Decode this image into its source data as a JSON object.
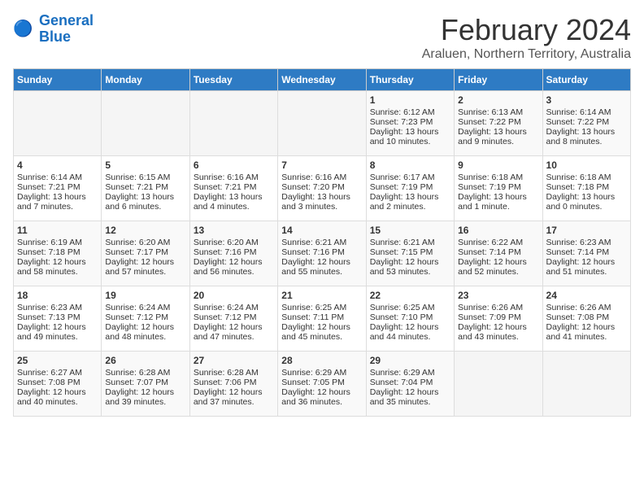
{
  "logo": {
    "text_general": "General",
    "text_blue": "Blue"
  },
  "title": "February 2024",
  "subtitle": "Araluen, Northern Territory, Australia",
  "headers": [
    "Sunday",
    "Monday",
    "Tuesday",
    "Wednesday",
    "Thursday",
    "Friday",
    "Saturday"
  ],
  "weeks": [
    [
      {
        "day": "",
        "lines": []
      },
      {
        "day": "",
        "lines": []
      },
      {
        "day": "",
        "lines": []
      },
      {
        "day": "",
        "lines": []
      },
      {
        "day": "1",
        "lines": [
          "Sunrise: 6:12 AM",
          "Sunset: 7:23 PM",
          "Daylight: 13 hours",
          "and 10 minutes."
        ]
      },
      {
        "day": "2",
        "lines": [
          "Sunrise: 6:13 AM",
          "Sunset: 7:22 PM",
          "Daylight: 13 hours",
          "and 9 minutes."
        ]
      },
      {
        "day": "3",
        "lines": [
          "Sunrise: 6:14 AM",
          "Sunset: 7:22 PM",
          "Daylight: 13 hours",
          "and 8 minutes."
        ]
      }
    ],
    [
      {
        "day": "4",
        "lines": [
          "Sunrise: 6:14 AM",
          "Sunset: 7:21 PM",
          "Daylight: 13 hours",
          "and 7 minutes."
        ]
      },
      {
        "day": "5",
        "lines": [
          "Sunrise: 6:15 AM",
          "Sunset: 7:21 PM",
          "Daylight: 13 hours",
          "and 6 minutes."
        ]
      },
      {
        "day": "6",
        "lines": [
          "Sunrise: 6:16 AM",
          "Sunset: 7:21 PM",
          "Daylight: 13 hours",
          "and 4 minutes."
        ]
      },
      {
        "day": "7",
        "lines": [
          "Sunrise: 6:16 AM",
          "Sunset: 7:20 PM",
          "Daylight: 13 hours",
          "and 3 minutes."
        ]
      },
      {
        "day": "8",
        "lines": [
          "Sunrise: 6:17 AM",
          "Sunset: 7:19 PM",
          "Daylight: 13 hours",
          "and 2 minutes."
        ]
      },
      {
        "day": "9",
        "lines": [
          "Sunrise: 6:18 AM",
          "Sunset: 7:19 PM",
          "Daylight: 13 hours",
          "and 1 minute."
        ]
      },
      {
        "day": "10",
        "lines": [
          "Sunrise: 6:18 AM",
          "Sunset: 7:18 PM",
          "Daylight: 13 hours",
          "and 0 minutes."
        ]
      }
    ],
    [
      {
        "day": "11",
        "lines": [
          "Sunrise: 6:19 AM",
          "Sunset: 7:18 PM",
          "Daylight: 12 hours",
          "and 58 minutes."
        ]
      },
      {
        "day": "12",
        "lines": [
          "Sunrise: 6:20 AM",
          "Sunset: 7:17 PM",
          "Daylight: 12 hours",
          "and 57 minutes."
        ]
      },
      {
        "day": "13",
        "lines": [
          "Sunrise: 6:20 AM",
          "Sunset: 7:16 PM",
          "Daylight: 12 hours",
          "and 56 minutes."
        ]
      },
      {
        "day": "14",
        "lines": [
          "Sunrise: 6:21 AM",
          "Sunset: 7:16 PM",
          "Daylight: 12 hours",
          "and 55 minutes."
        ]
      },
      {
        "day": "15",
        "lines": [
          "Sunrise: 6:21 AM",
          "Sunset: 7:15 PM",
          "Daylight: 12 hours",
          "and 53 minutes."
        ]
      },
      {
        "day": "16",
        "lines": [
          "Sunrise: 6:22 AM",
          "Sunset: 7:14 PM",
          "Daylight: 12 hours",
          "and 52 minutes."
        ]
      },
      {
        "day": "17",
        "lines": [
          "Sunrise: 6:23 AM",
          "Sunset: 7:14 PM",
          "Daylight: 12 hours",
          "and 51 minutes."
        ]
      }
    ],
    [
      {
        "day": "18",
        "lines": [
          "Sunrise: 6:23 AM",
          "Sunset: 7:13 PM",
          "Daylight: 12 hours",
          "and 49 minutes."
        ]
      },
      {
        "day": "19",
        "lines": [
          "Sunrise: 6:24 AM",
          "Sunset: 7:12 PM",
          "Daylight: 12 hours",
          "and 48 minutes."
        ]
      },
      {
        "day": "20",
        "lines": [
          "Sunrise: 6:24 AM",
          "Sunset: 7:12 PM",
          "Daylight: 12 hours",
          "and 47 minutes."
        ]
      },
      {
        "day": "21",
        "lines": [
          "Sunrise: 6:25 AM",
          "Sunset: 7:11 PM",
          "Daylight: 12 hours",
          "and 45 minutes."
        ]
      },
      {
        "day": "22",
        "lines": [
          "Sunrise: 6:25 AM",
          "Sunset: 7:10 PM",
          "Daylight: 12 hours",
          "and 44 minutes."
        ]
      },
      {
        "day": "23",
        "lines": [
          "Sunrise: 6:26 AM",
          "Sunset: 7:09 PM",
          "Daylight: 12 hours",
          "and 43 minutes."
        ]
      },
      {
        "day": "24",
        "lines": [
          "Sunrise: 6:26 AM",
          "Sunset: 7:08 PM",
          "Daylight: 12 hours",
          "and 41 minutes."
        ]
      }
    ],
    [
      {
        "day": "25",
        "lines": [
          "Sunrise: 6:27 AM",
          "Sunset: 7:08 PM",
          "Daylight: 12 hours",
          "and 40 minutes."
        ]
      },
      {
        "day": "26",
        "lines": [
          "Sunrise: 6:28 AM",
          "Sunset: 7:07 PM",
          "Daylight: 12 hours",
          "and 39 minutes."
        ]
      },
      {
        "day": "27",
        "lines": [
          "Sunrise: 6:28 AM",
          "Sunset: 7:06 PM",
          "Daylight: 12 hours",
          "and 37 minutes."
        ]
      },
      {
        "day": "28",
        "lines": [
          "Sunrise: 6:29 AM",
          "Sunset: 7:05 PM",
          "Daylight: 12 hours",
          "and 36 minutes."
        ]
      },
      {
        "day": "29",
        "lines": [
          "Sunrise: 6:29 AM",
          "Sunset: 7:04 PM",
          "Daylight: 12 hours",
          "and 35 minutes."
        ]
      },
      {
        "day": "",
        "lines": []
      },
      {
        "day": "",
        "lines": []
      }
    ]
  ]
}
